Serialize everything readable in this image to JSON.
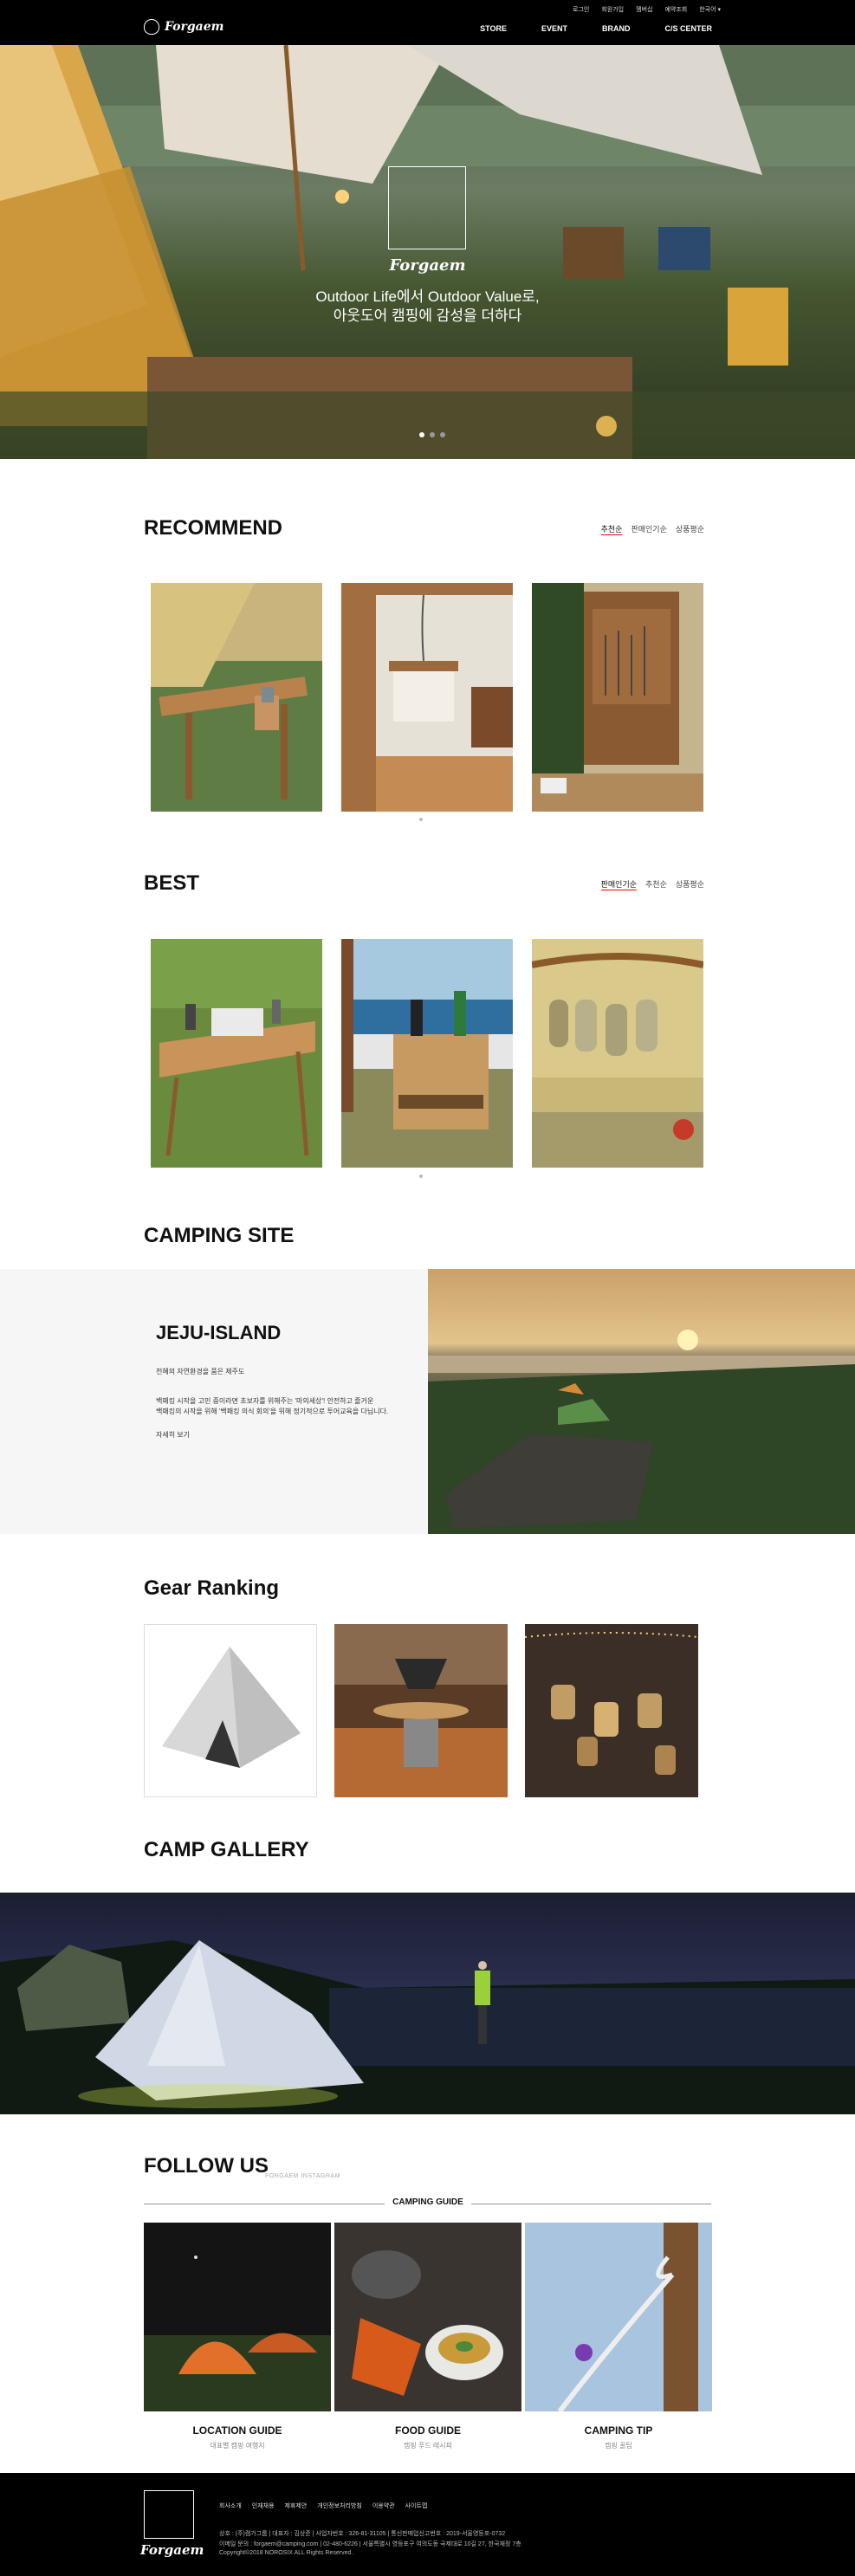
{
  "header": {
    "brand": "Forgaem",
    "util": [
      "로그인",
      "회원가입",
      "멤버십",
      "예약조회",
      "한국어 ▾"
    ],
    "nav": [
      "STORE",
      "EVENT",
      "BRAND",
      "C/S CENTER"
    ]
  },
  "hero": {
    "brand": "Forgaem",
    "line1": "Outdoor Life에서 Outdoor Value로,",
    "line2": "아웃도어 캠핑에 감성을 더하다",
    "slides": 3,
    "active_slide": 1
  },
  "recommend": {
    "title": "RECOMMEND",
    "sort": [
      "추천순",
      "판매인기순",
      "상품평순"
    ],
    "active_sort": 0
  },
  "best": {
    "title": "BEST",
    "sort": [
      "판매인기순",
      "추천순",
      "상품평순"
    ],
    "active_sort": 0
  },
  "camping_site": {
    "title": "CAMPING SITE",
    "name": "JEJU-ISLAND",
    "p1": "천혜의 자연환경을 품은 제주도",
    "p2": "백패킹 시작을 고민 중이라면 초보자를 위해주는 '마의세상'! 안전하고 즐거운",
    "p3": "백패킹의 시작을 위해 '백패킹 의식 회의'을 위해 정기적으로 투어교육을 다닙니다.",
    "more": "자세히 보기"
  },
  "gear_ranking": {
    "title": "Gear Ranking"
  },
  "gallery": {
    "title": "CAMP GALLERY"
  },
  "follow": {
    "title": "FOLLOW US",
    "subtitle": "FORGAEM INSTAGRAM",
    "guide_label": "CAMPING GUIDE",
    "items": [
      {
        "title": "LOCATION GUIDE",
        "sub": "대표별 캠핑 여행지"
      },
      {
        "title": "FOOD GUIDE",
        "sub": "캠핑 푸드 레시피"
      },
      {
        "title": "CAMPING TIP",
        "sub": "캠핑 꿀팁"
      }
    ]
  },
  "footer": {
    "brand": "Forgaem",
    "links": [
      "회사소개",
      "인재채용",
      "제휴제안",
      "개인정보처리방침",
      "이용약관",
      "사이트맵"
    ],
    "info1": "상호 : (주)캠가그룹 | 대표자 : 김상준 | 사업자번호 : 326-81-31105 | 통신판매업신고번호 : 2019-서울영등포-0732",
    "info2": "이메일 문의 : forgaem@camping.com | 02-480-6226 | 서울특별시 영등포구 여의도동 국제대로 10길 27, 한국재정 7층",
    "copyright": "Copyright©2018 NOROSIX ALL Rights Reserved."
  },
  "colors": {
    "header_bg": "#000000",
    "accent_underline": "#e00000",
    "site_panel_bg": "#f6f6f6"
  }
}
